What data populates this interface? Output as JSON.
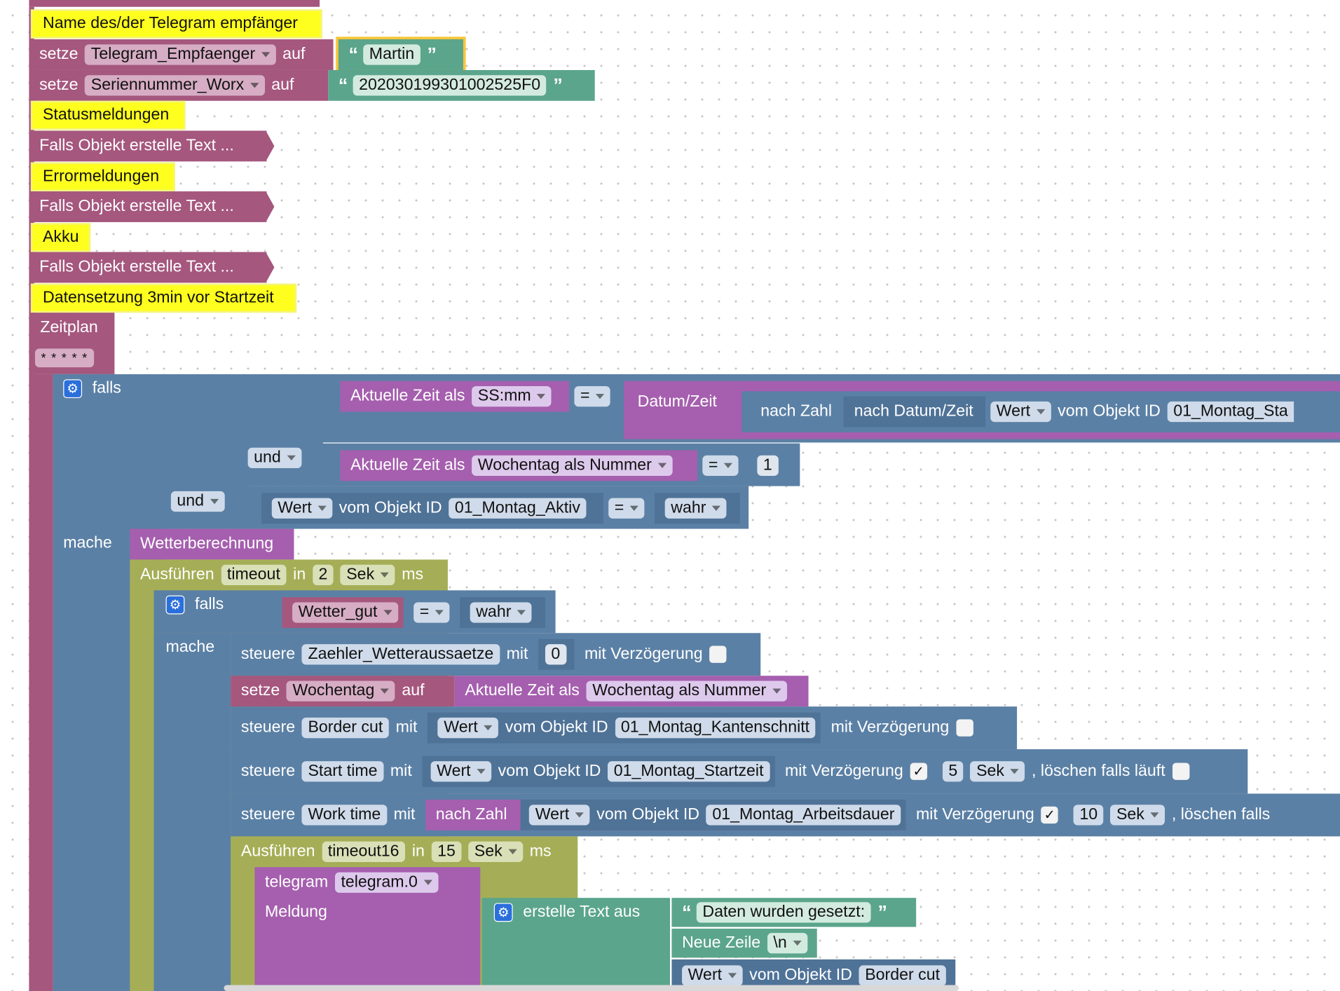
{
  "comments": {
    "c1": "Name des/der Telegram empfänger",
    "c2": "Statusmeldungen",
    "c3": "Errormeldungen",
    "c4": "Akku",
    "c5": "Datensetzung 3min vor Startzeit"
  },
  "words": {
    "set": "setze",
    "to": "auf",
    "make_text": "Falls Objekt erstelle Text ...",
    "schedule": "Zeitplan",
    "if": "falls",
    "and": "und",
    "do": "mache",
    "current_time_as": "Aktuelle Zeit als",
    "equals": "=",
    "datetime": "Datum/Zeit",
    "to_number": "nach Zahl",
    "to_datetime": "nach Datum/Zeit",
    "value": "Wert",
    "of_object": "vom Objekt ID",
    "true": "wahr",
    "control": "steuere",
    "with": "mit",
    "with_delay": "mit Verzögerung",
    "clear_running": ", löschen falls läuft",
    "clear_running_cut": ", löschen falls",
    "execute": "Ausführen",
    "in": "in",
    "ms": "ms",
    "telegram": "telegram",
    "message": "Meldung",
    "create_text": "erstelle Text aus",
    "newline": "Neue Zeile",
    "check": "✓"
  },
  "vars": {
    "recipient": "Telegram_Empfaenger",
    "serial": "Seriennummer_Worx",
    "weather_good": "Wetter_gut",
    "weekday": "Wochentag",
    "timeout": "timeout",
    "timeout16": "timeout16"
  },
  "strings": {
    "martin": "Martin",
    "serial_value": "202030199301002525F0",
    "data_set": "Daten wurden gesetzt:"
  },
  "cron": "* * * * *",
  "formats": {
    "hhmm": "SS:mm",
    "weekday_number": "Wochentag als Nummer",
    "sec": "Sek",
    "newline_code": "\\n"
  },
  "numbers": {
    "one": "1",
    "zero": "0",
    "two": "2",
    "five": "5",
    "ten": "10",
    "fifteen": "15"
  },
  "objects": {
    "start_cut": "01_Montag_Sta",
    "active": "01_Montag_Aktiv",
    "edge_cut": "01_Montag_Kantenschnitt",
    "start_time": "01_Montag_Startzeit",
    "work_duration": "01_Montag_Arbeitsdauer",
    "counter": "Zaehler_Wetteraussaetze",
    "border_cut": "Border cut",
    "start": "Start time",
    "work": "Work time",
    "telegram_instance": "telegram.0"
  },
  "procedure": "Wetterberechnung"
}
